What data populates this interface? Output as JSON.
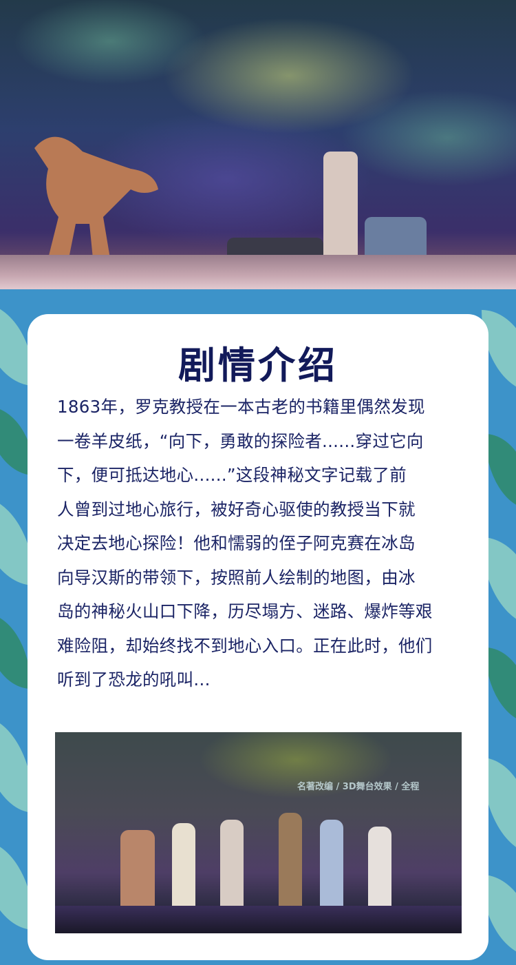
{
  "hero_photo": {
    "alt": "stage-scene-dinosaur-and-explorers"
  },
  "section": {
    "title": "剧情介绍",
    "body_lines": [
      "1863年，罗克教授在一本古老的书籍里偶然发现",
      "一卷羊皮纸，“向下，勇敢的探险者......穿过它向",
      "下，便可抵达地心......”这段神秘文字记载了前",
      "人曾到过地心旅行，被好奇心驱使的教授当下就",
      "决定去地心探险！他和懦弱的侄子阿克赛在冰岛",
      "向导汉斯的带领下，按照前人绘制的地图，由冰",
      "岛的神秘火山口下降，历尽塌方、迷路、爆炸等艰",
      "难险阻，却始终找不到地心入口。正在此时，他们",
      "听到了恐龙的吼叫..."
    ]
  },
  "bottom_photo": {
    "backdrop_text": "名著改编 / 3D舞台效果 / 全程"
  },
  "colors": {
    "frame_blue": "#3d93c9",
    "title_navy": "#121a5a",
    "text_navy": "#1b2465",
    "card": "#ffffff"
  }
}
